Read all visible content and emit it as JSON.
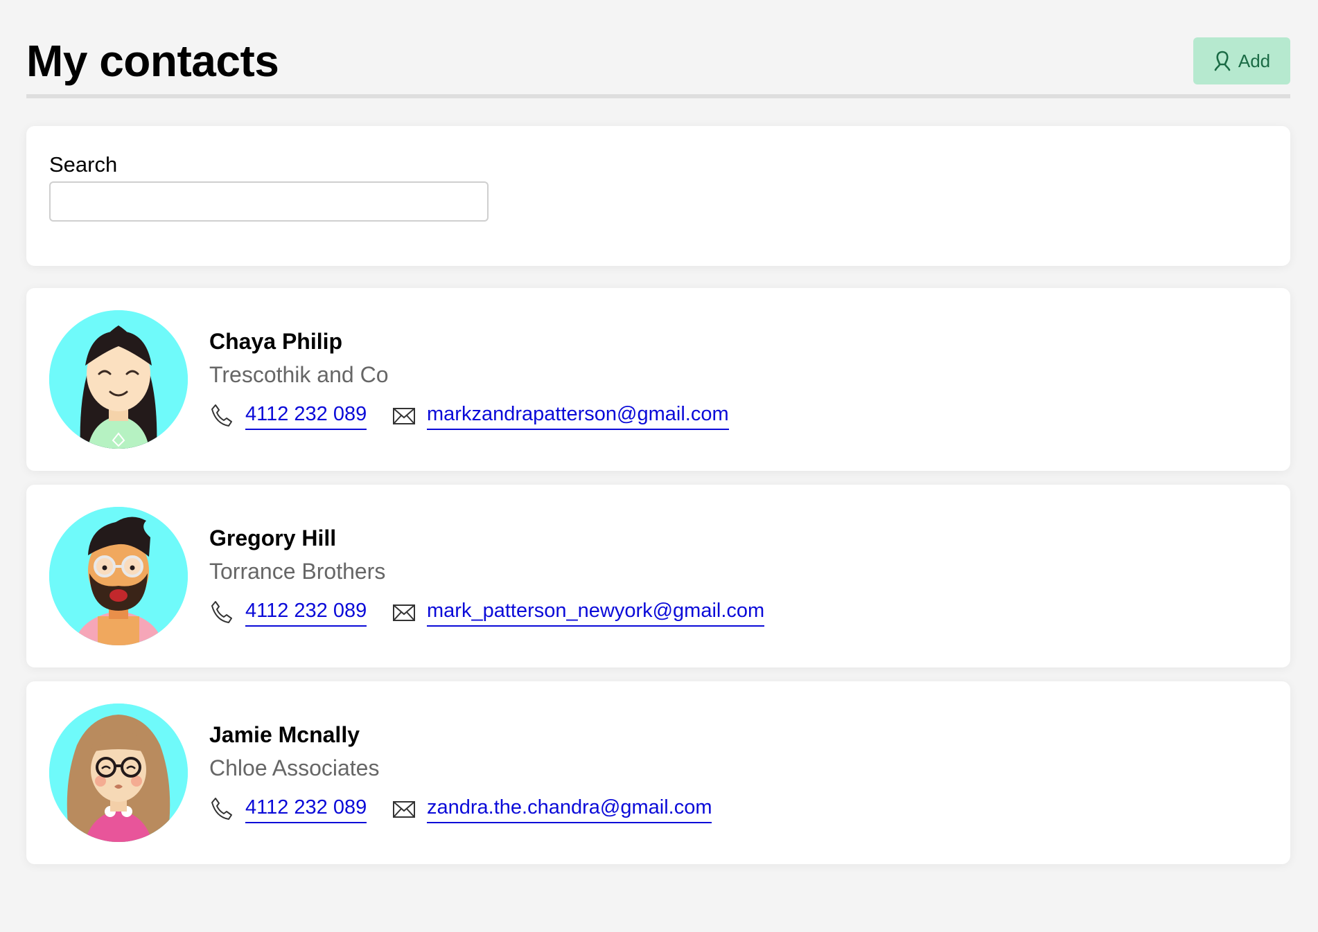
{
  "page": {
    "title": "My contacts"
  },
  "header": {
    "add_label": "Add",
    "add_icon": "person-add-icon",
    "add_color": "#b6e9cf"
  },
  "search": {
    "label": "Search",
    "value": "",
    "placeholder": ""
  },
  "contacts": [
    {
      "name": "Chaya Philip",
      "company": "Trescothik and Co",
      "phone": "4112 232 089",
      "email": "markzandrapatterson@gmail.com",
      "avatar_icon": "woman-avatar-icon"
    },
    {
      "name": "Gregory Hill",
      "company": "Torrance Brothers",
      "phone": "4112 232 089",
      "email": "mark_patterson_newyork@gmail.com",
      "avatar_icon": "bearded-man-avatar-icon"
    },
    {
      "name": "Jamie Mcnally",
      "company": "Chloe Associates",
      "phone": "4112 232 089",
      "email": "zandra.the.chandra@gmail.com",
      "avatar_icon": "woman-glasses-avatar-icon"
    }
  ],
  "colors": {
    "link": "#0a0ad8",
    "avatar_bg": "#6ffafa",
    "page_bg": "#f4f4f4"
  }
}
